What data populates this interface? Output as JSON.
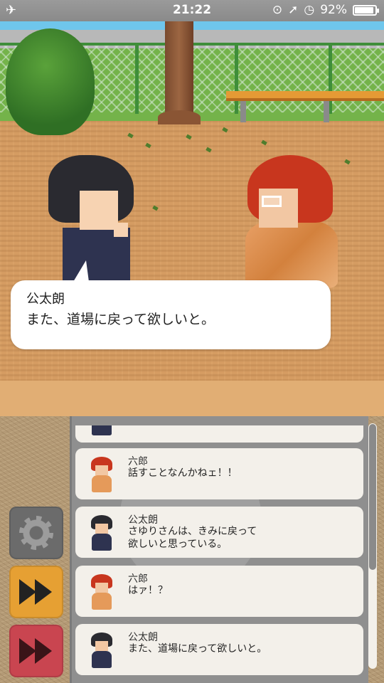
{
  "status_bar": {
    "left_icon": "airplane-icon",
    "time": "21:22",
    "battery_percent": "92%",
    "battery_level": 0.92,
    "icons": [
      "orientation-lock-icon",
      "location-icon",
      "alarm-icon",
      "battery-icon"
    ]
  },
  "dialog": {
    "speaker": "公太朗",
    "text": "また、道場に戻って欲しいと。"
  },
  "log": [
    {
      "speaker": "六郎",
      "text": "話すことなんかねェ！！",
      "avatar": "rokuro"
    },
    {
      "speaker": "公太朗",
      "text": "さゆりさんは、きみに戻って\n欲しいと思っている。",
      "avatar": "kotaro"
    },
    {
      "speaker": "六郎",
      "text": "はァ！？",
      "avatar": "rokuro"
    },
    {
      "speaker": "公太朗",
      "text": "また、道場に戻って欲しいと。",
      "avatar": "kotaro"
    }
  ],
  "buttons": {
    "settings_icon": "gear-icon",
    "skip_icon": "fast-forward-icon",
    "auto_icon": "fast-forward-icon",
    "colors": {
      "settings": "#6b6b6b",
      "skip": "#e6a033",
      "auto": "#c94550"
    }
  }
}
